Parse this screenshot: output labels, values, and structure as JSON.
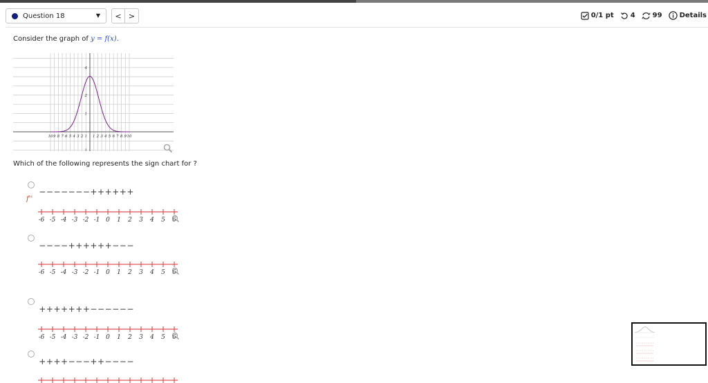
{
  "header": {
    "question_label": "Question 18",
    "points": "0/1 pt",
    "retries": "4",
    "submissions": "99",
    "details": "Details",
    "prev_glyph": "<",
    "next_glyph": ">"
  },
  "prompt": {
    "lead": "Consider the graph of",
    "math": "y = f(x)."
  },
  "graph": {
    "x_ticks": [
      "10",
      "9",
      "8",
      "7",
      "6",
      "5",
      "4",
      "3",
      "2",
      "1",
      "1",
      "2",
      "3",
      "4",
      "5",
      "6",
      "7",
      "8",
      "9",
      "10"
    ],
    "y_ticks": [
      "4",
      "2",
      "1",
      "1"
    ],
    "curve_color": "#7b1f8c"
  },
  "question": {
    "lead": "Which of the following represents the sign chart for",
    "math": "f''",
    "trail": "?"
  },
  "options": [
    {
      "signs": [
        "−",
        "−",
        "−",
        "−",
        "−",
        "−",
        "−",
        "+",
        "+",
        "+",
        "+",
        "+",
        "+"
      ]
    },
    {
      "signs": [
        "−",
        "−",
        "−",
        "−",
        "+",
        "+",
        "+",
        "+",
        "+",
        "+",
        "−",
        "−",
        "−"
      ]
    },
    {
      "signs": [
        "+",
        "+",
        "+",
        "+",
        "+",
        "+",
        "+",
        "−",
        "−",
        "−",
        "−",
        "−",
        "−"
      ]
    },
    {
      "signs": [
        "+",
        "+",
        "+",
        "+",
        "−",
        "−",
        "−",
        "+",
        "+",
        "−",
        "−",
        "−",
        "−"
      ]
    }
  ],
  "numberline": {
    "labels": [
      "-6",
      "-5",
      "-4",
      "-3",
      "-2",
      "-1",
      "0",
      "1",
      "2",
      "3",
      "4",
      "5",
      "6"
    ],
    "color": "#d62828"
  }
}
